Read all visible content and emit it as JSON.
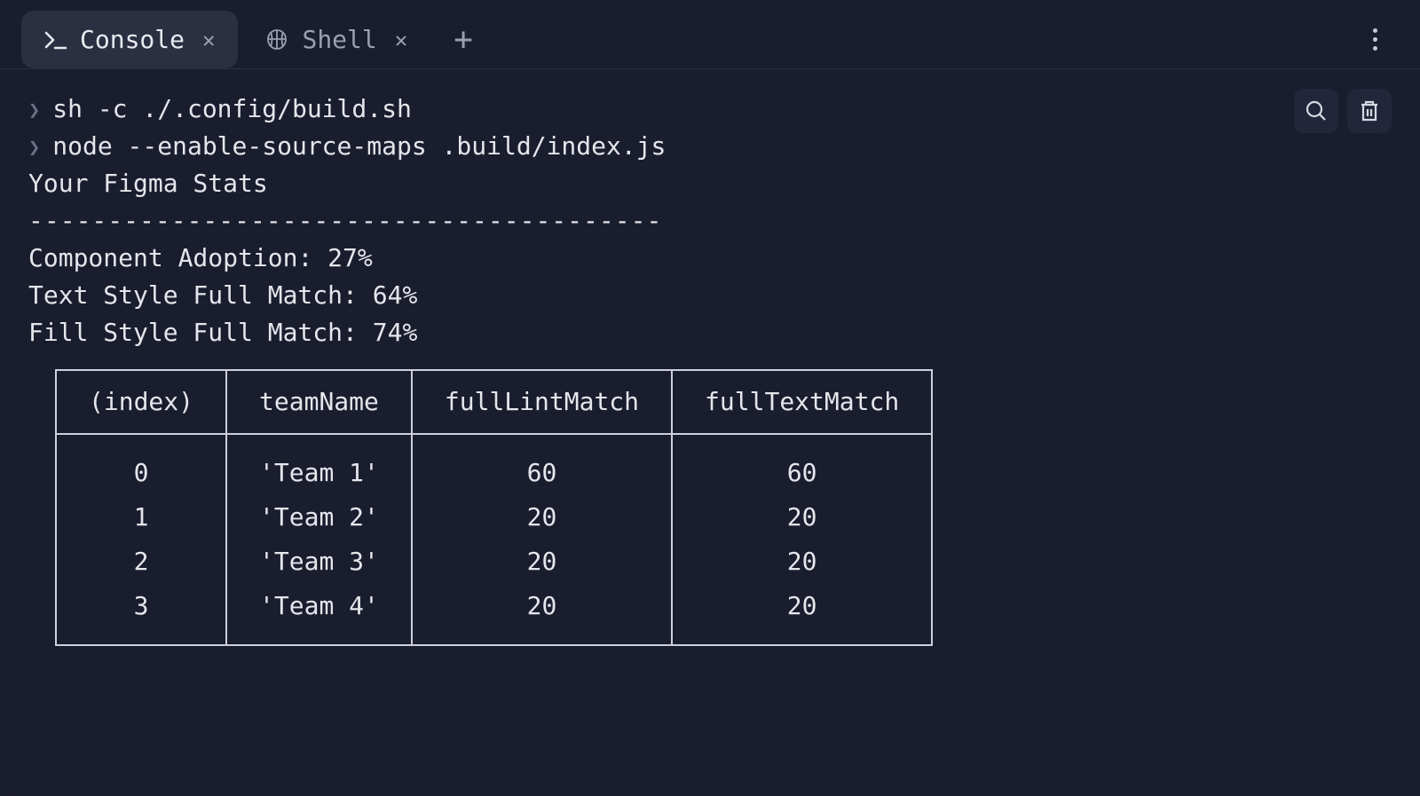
{
  "tabs": [
    {
      "label": "Console",
      "active": true,
      "icon": "terminal"
    },
    {
      "label": "Shell",
      "active": false,
      "icon": "shell"
    }
  ],
  "commands": [
    "sh -c ./.config/build.sh",
    "node --enable-source-maps .build/index.js"
  ],
  "outputTitle": "Your Figma Stats",
  "divider": "----------------------------------------",
  "stats": {
    "componentAdoption": {
      "label": "Component Adoption",
      "value": "27%"
    },
    "textStyleMatch": {
      "label": "Text Style Full Match",
      "value": "64%"
    },
    "fillStyleMatch": {
      "label": "Fill Style Full Match",
      "value": "74%"
    }
  },
  "table": {
    "headers": [
      "(index)",
      "teamName",
      "fullLintMatch",
      "fullTextMatch"
    ],
    "rows": [
      {
        "index": "0",
        "teamName": "'Team 1'",
        "fullLintMatch": "60",
        "fullTextMatch": "60"
      },
      {
        "index": "1",
        "teamName": "'Team 2'",
        "fullLintMatch": "20",
        "fullTextMatch": "20"
      },
      {
        "index": "2",
        "teamName": "'Team 3'",
        "fullLintMatch": "20",
        "fullTextMatch": "20"
      },
      {
        "index": "3",
        "teamName": "'Team 4'",
        "fullLintMatch": "20",
        "fullTextMatch": "20"
      }
    ]
  }
}
